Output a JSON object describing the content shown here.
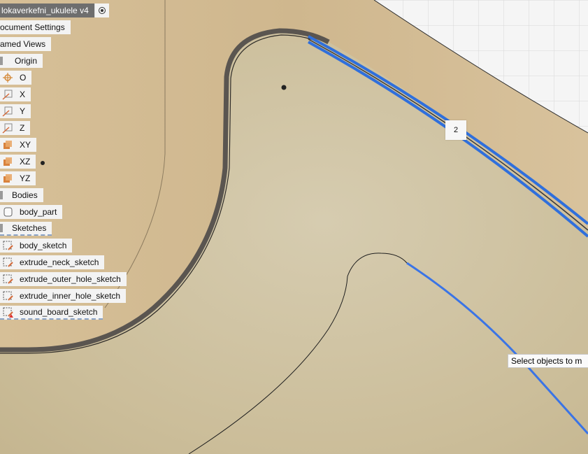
{
  "document": {
    "title": "lokaverkefni_ukulele v4"
  },
  "browser": {
    "document_settings": "ocument Settings",
    "named_views": "amed Views",
    "origin": {
      "label": "Origin",
      "items": [
        "O",
        "X",
        "Y",
        "Z",
        "XY",
        "XZ",
        "YZ"
      ]
    },
    "bodies": {
      "label": "Bodies",
      "items": [
        "body_part"
      ]
    },
    "sketches": {
      "label": "Sketches",
      "items": [
        "body_sketch",
        "extrude_neck_sketch",
        "extrude_outer_hole_sketch",
        "extrude_inner_hole_sketch",
        "sound_board_sketch"
      ]
    }
  },
  "canvas": {
    "selection_count": "2",
    "tooltip": "Select objects to m"
  },
  "colors": {
    "wood": "#d4bc94",
    "surface": "#cdbf9c",
    "selection": "#2f6fdc",
    "panel": "#f3f3f3"
  },
  "icons": {
    "origin_point": "origin-point-icon",
    "axis": "axis-icon",
    "plane": "plane-icon",
    "body": "body-icon",
    "sketch": "sketch-icon",
    "visibility": "radio-target-icon"
  }
}
